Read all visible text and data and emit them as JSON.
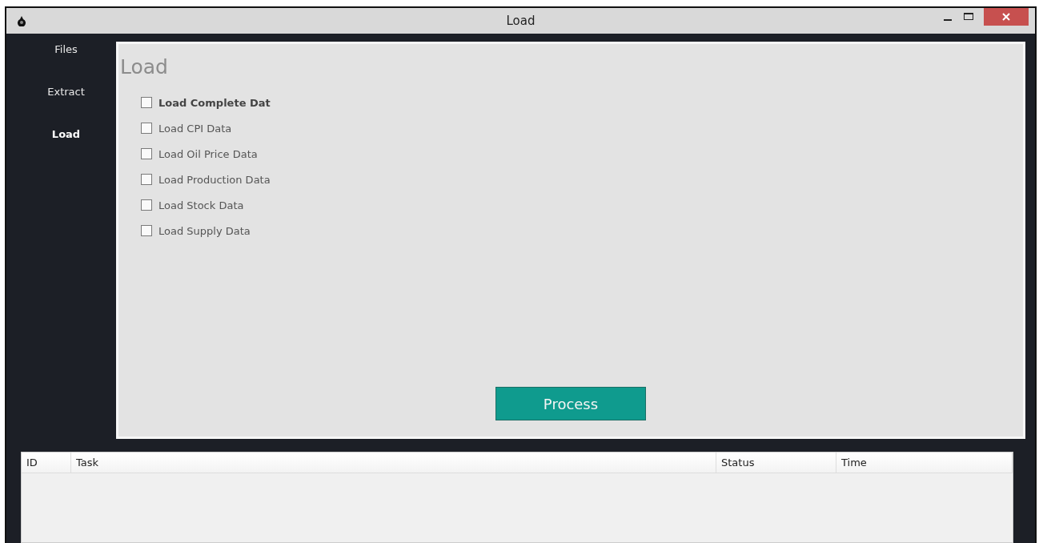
{
  "window": {
    "title": "Load"
  },
  "sidebar": {
    "items": [
      {
        "label": "Files",
        "selected": false
      },
      {
        "label": "Extract",
        "selected": false
      },
      {
        "label": "Load",
        "selected": true
      }
    ]
  },
  "panel": {
    "heading": "Load",
    "options": [
      {
        "label": "Load Complete Dat",
        "checked": false,
        "focused": true
      },
      {
        "label": "Load CPI Data",
        "checked": false,
        "focused": false
      },
      {
        "label": "Load Oil Price Data",
        "checked": false,
        "focused": false
      },
      {
        "label": "Load Production Data",
        "checked": false,
        "focused": false
      },
      {
        "label": "Load Stock Data",
        "checked": false,
        "focused": false
      },
      {
        "label": "Load Supply Data",
        "checked": false,
        "focused": false
      }
    ],
    "button": "Process"
  },
  "table": {
    "columns": [
      "ID",
      "Task",
      "Status",
      "Time"
    ]
  }
}
